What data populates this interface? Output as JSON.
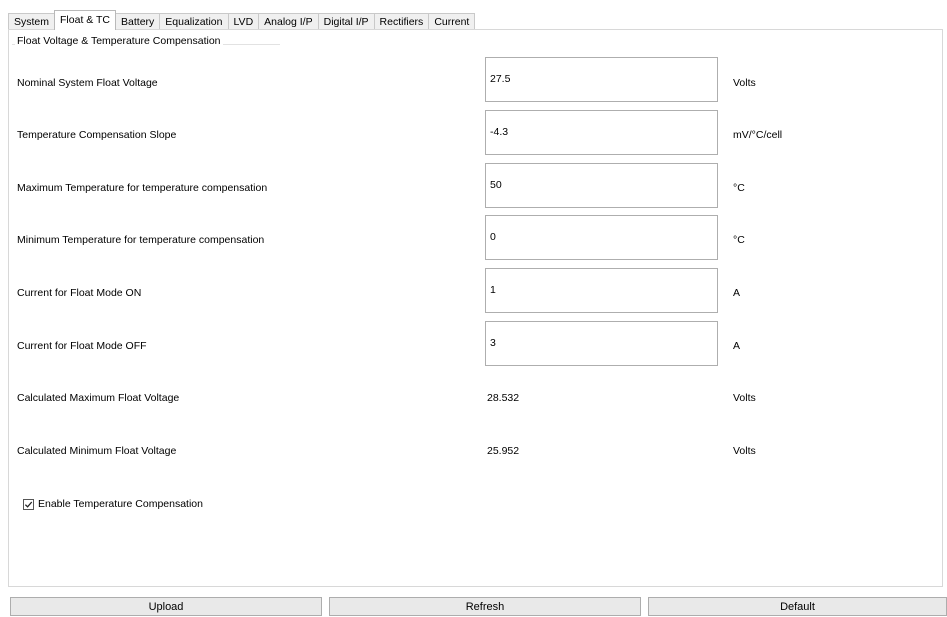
{
  "tabs": [
    "System",
    "Float & TC",
    "Battery",
    "Equalization",
    "LVD",
    "Analog I/P",
    "Digital I/P",
    "Rectifiers",
    "Current"
  ],
  "active_tab": "Float & TC",
  "group_title": "Float Voltage & Temperature Compensation",
  "fields": [
    {
      "label": "Nominal System Float Voltage",
      "value": "27.5",
      "unit": "Volts"
    },
    {
      "label": "Temperature Compensation Slope",
      "value": "-4.3",
      "unit": "mV/°C/cell"
    },
    {
      "label": "Maximum Temperature for temperature compensation",
      "value": "50",
      "unit": "°C"
    },
    {
      "label": "Minimum Temperature for temperature compensation",
      "value": "0",
      "unit": "°C"
    },
    {
      "label": "Current for Float Mode ON",
      "value": "1",
      "unit": "A"
    },
    {
      "label": "Current for Float Mode OFF",
      "value": "3",
      "unit": "A"
    }
  ],
  "calculated": [
    {
      "label": "Calculated Maximum Float Voltage",
      "value": "28.532",
      "unit": "Volts"
    },
    {
      "label": "Calculated Minimum Float Voltage",
      "value": "25.952",
      "unit": "Volts"
    }
  ],
  "enable_tc": {
    "label": "Enable Temperature Compensation",
    "checked": true
  },
  "buttons": {
    "upload": "Upload",
    "refresh": "Refresh",
    "default": "Default"
  }
}
